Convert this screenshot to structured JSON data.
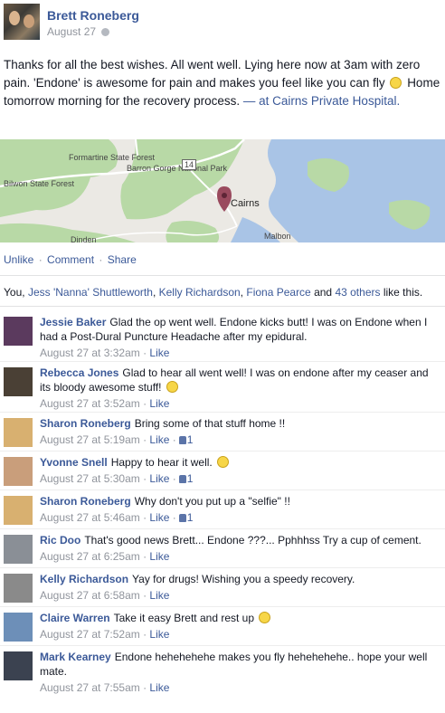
{
  "post": {
    "author": "Brett Roneberg",
    "date": "August 27",
    "privacy_icon": "globe-icon",
    "text": "Thanks for all the best wishes. All went well. Lying here now at 3am with zero pain. 'Endone' is awesome for pain and makes you feel like you can fly",
    "text2": "Home tomorrow morning for the recovery process.",
    "location_prefix": "— at",
    "location": "Cairns Private Hospital."
  },
  "map": {
    "labels": {
      "formartine": "Formartine State Forest",
      "barron": "Barron Gorge National Park",
      "bilwon": "Bilwon State Forest",
      "road14": "14",
      "cairns": "Cairns",
      "dinden": "Dinden",
      "malbon": "Malbon"
    },
    "colors": {
      "water": "#a9c4e6",
      "forest": "#b8d9a6",
      "land": "#ebe9e4"
    }
  },
  "actions": {
    "unlike": "Unlike",
    "comment": "Comment",
    "share": "Share",
    "sep": "·"
  },
  "likes": {
    "prefix": "You,",
    "names": [
      "Jess 'Nanna' Shuttleworth",
      "Kelly Richardson",
      "Fiona Pearce"
    ],
    "and": "and",
    "others": "43 others",
    "suffix": "like this.",
    "comma": ","
  },
  "comments": [
    {
      "name": "Jessie Baker",
      "text": "Glad the op went well. Endone kicks butt! I was on Endone when I had a Post-Dural Puncture Headache after my epidural.",
      "time": "August 27 at 3:32am",
      "like": "Like",
      "likes": "",
      "emoji": ""
    },
    {
      "name": "Rebecca Jones",
      "text": "Glad to hear all went well! I was on endone after my ceaser and its bloody awesome stuff!",
      "time": "August 27 at 3:52am",
      "like": "Like",
      "likes": "",
      "emoji": "grin"
    },
    {
      "name": "Sharon Roneberg",
      "text": "Bring some of that stuff home !!",
      "time": "August 27 at 5:19am",
      "like": "Like",
      "likes": "1",
      "emoji": ""
    },
    {
      "name": "Yvonne Snell",
      "text": "Happy to hear it well.",
      "time": "August 27 at 5:30am",
      "like": "Like",
      "likes": "1",
      "emoji": "smile"
    },
    {
      "name": "Sharon Roneberg",
      "text": "Why don't you put up a \"selfie\" !!",
      "time": "August 27 at 5:46am",
      "like": "Like",
      "likes": "1",
      "emoji": ""
    },
    {
      "name": "Ric Doo",
      "text": "That's good news Brett... Endone ???... Pphhhss Try a cup of cement.",
      "time": "August 27 at 6:25am",
      "like": "Like",
      "likes": "",
      "emoji": ""
    },
    {
      "name": "Kelly Richardson",
      "text": "Yay for drugs! Wishing you a speedy recovery.",
      "time": "August 27 at 6:58am",
      "like": "Like",
      "likes": "",
      "emoji": ""
    },
    {
      "name": "Claire Warren",
      "text": "Take it easy Brett and rest up",
      "time": "August 27 at 7:52am",
      "like": "Like",
      "likes": "",
      "emoji": "smile"
    },
    {
      "name": "Mark Kearney",
      "text": "Endone hehehehehe makes you fly hehehehehe.. hope your well mate.",
      "time": "August 27 at 7:55am",
      "like": "Like",
      "likes": "",
      "emoji": ""
    }
  ]
}
